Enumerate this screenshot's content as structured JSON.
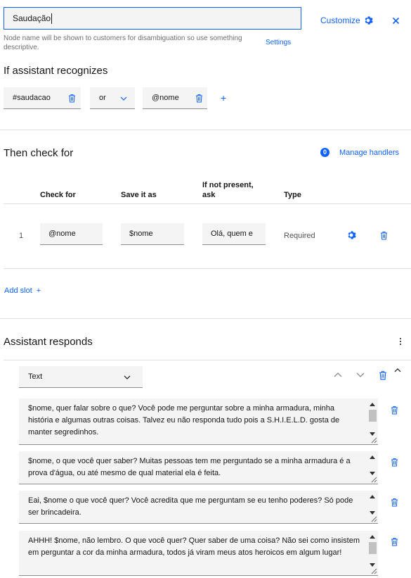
{
  "header": {
    "node_name_value": "Saudação",
    "customize_label": "Customize",
    "node_name_helper": "Node name will be shown to customers for disambiguation so use something descriptive.",
    "settings_link": "Settings"
  },
  "recognizes": {
    "title": "If assistant recognizes",
    "condition1": "#saudacao",
    "operator": "or",
    "condition2": "@nome",
    "add_symbol": "+"
  },
  "check": {
    "title": "Then check for",
    "handlers_count": "0",
    "manage_handlers": "Manage handlers",
    "columns": {
      "check_for": "Check for",
      "save_as": "Save it as",
      "if_not_present_line1": "If not present,",
      "if_not_present_line2": "ask",
      "type": "Type"
    },
    "slots": [
      {
        "index": "1",
        "check_for": "@nome",
        "save_as": "$nome",
        "ask": "Olá,  quem e",
        "type": "Required"
      }
    ],
    "add_slot": "Add slot",
    "add_slot_symbol": "+"
  },
  "responds": {
    "title": "Assistant responds",
    "response_type": "Text",
    "messages": [
      "$nome, quer falar sobre o que?  Você pode me perguntar sobre a minha armadura, minha história e algumas outras coisas. Talvez eu não responda tudo pois a S.H.I.E.L.D. gosta de manter segredinhos.",
      "$nome, o que você quer saber? Muitas pessoas tem me perguntado se a minha armadura é a prova d'água, ou até mesmo de qual material ela é feita.",
      "Eai, $nome o que você quer? Você acredita que me perguntam se eu tenho poderes? Só pode ser brincadeira.",
      "AHHH! $nome, não lembro. O que você quer? Quer saber de uma coisa? Não sei como insistem em perguntar a cor da minha armadura, todos já viram meus atos heroicos em algum lugar!"
    ]
  },
  "colors": {
    "accent": "#0f62fe",
    "field_background": "#f4f4f4",
    "divider": "#e0e0e0"
  }
}
